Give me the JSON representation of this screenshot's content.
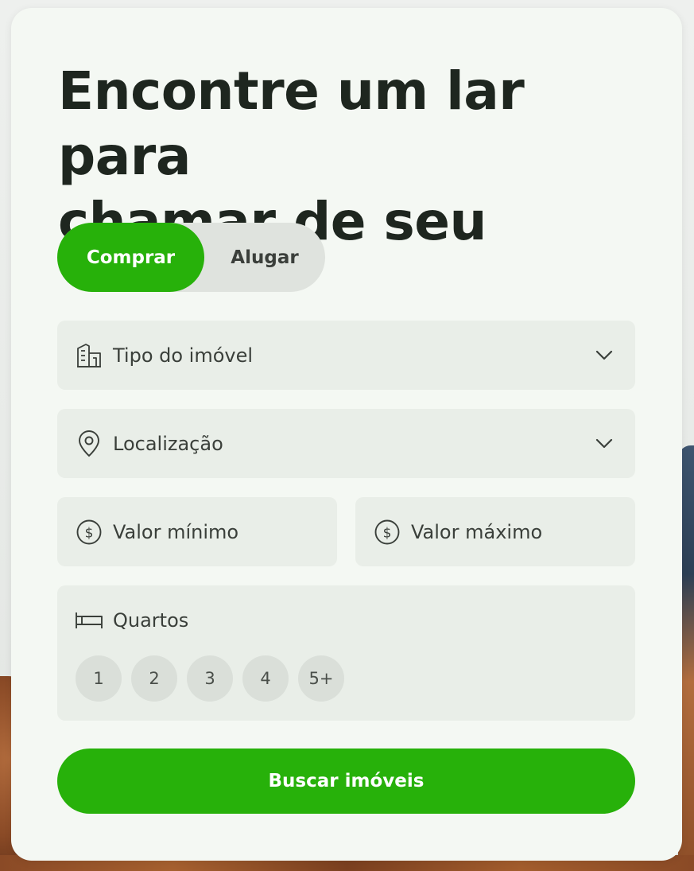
{
  "card": {
    "title_line1": "Encontre um lar para",
    "title_line2": "chamar de seu"
  },
  "mode_toggle": {
    "options": [
      {
        "label": "Comprar",
        "selected": true
      },
      {
        "label": "Alugar",
        "selected": false
      }
    ]
  },
  "filters": {
    "property_type": {
      "label": "Tipo do imóvel",
      "icon": "building-icon"
    },
    "location": {
      "label": "Localização",
      "icon": "map-pin-icon"
    },
    "min_price": {
      "label": "Valor mínimo",
      "icon": "dollar-circle-icon"
    },
    "max_price": {
      "label": "Valor máximo",
      "icon": "dollar-circle-icon"
    },
    "bedrooms": {
      "label": "Quartos",
      "icon": "bed-icon",
      "options": [
        "1",
        "2",
        "3",
        "4",
        "5+"
      ]
    }
  },
  "submit": {
    "label": "Buscar imóveis"
  },
  "colors": {
    "accent": "#27b10a",
    "card_background": "#f4f8f3",
    "field_background": "#e9eee8",
    "title_text": "#1e261f"
  }
}
